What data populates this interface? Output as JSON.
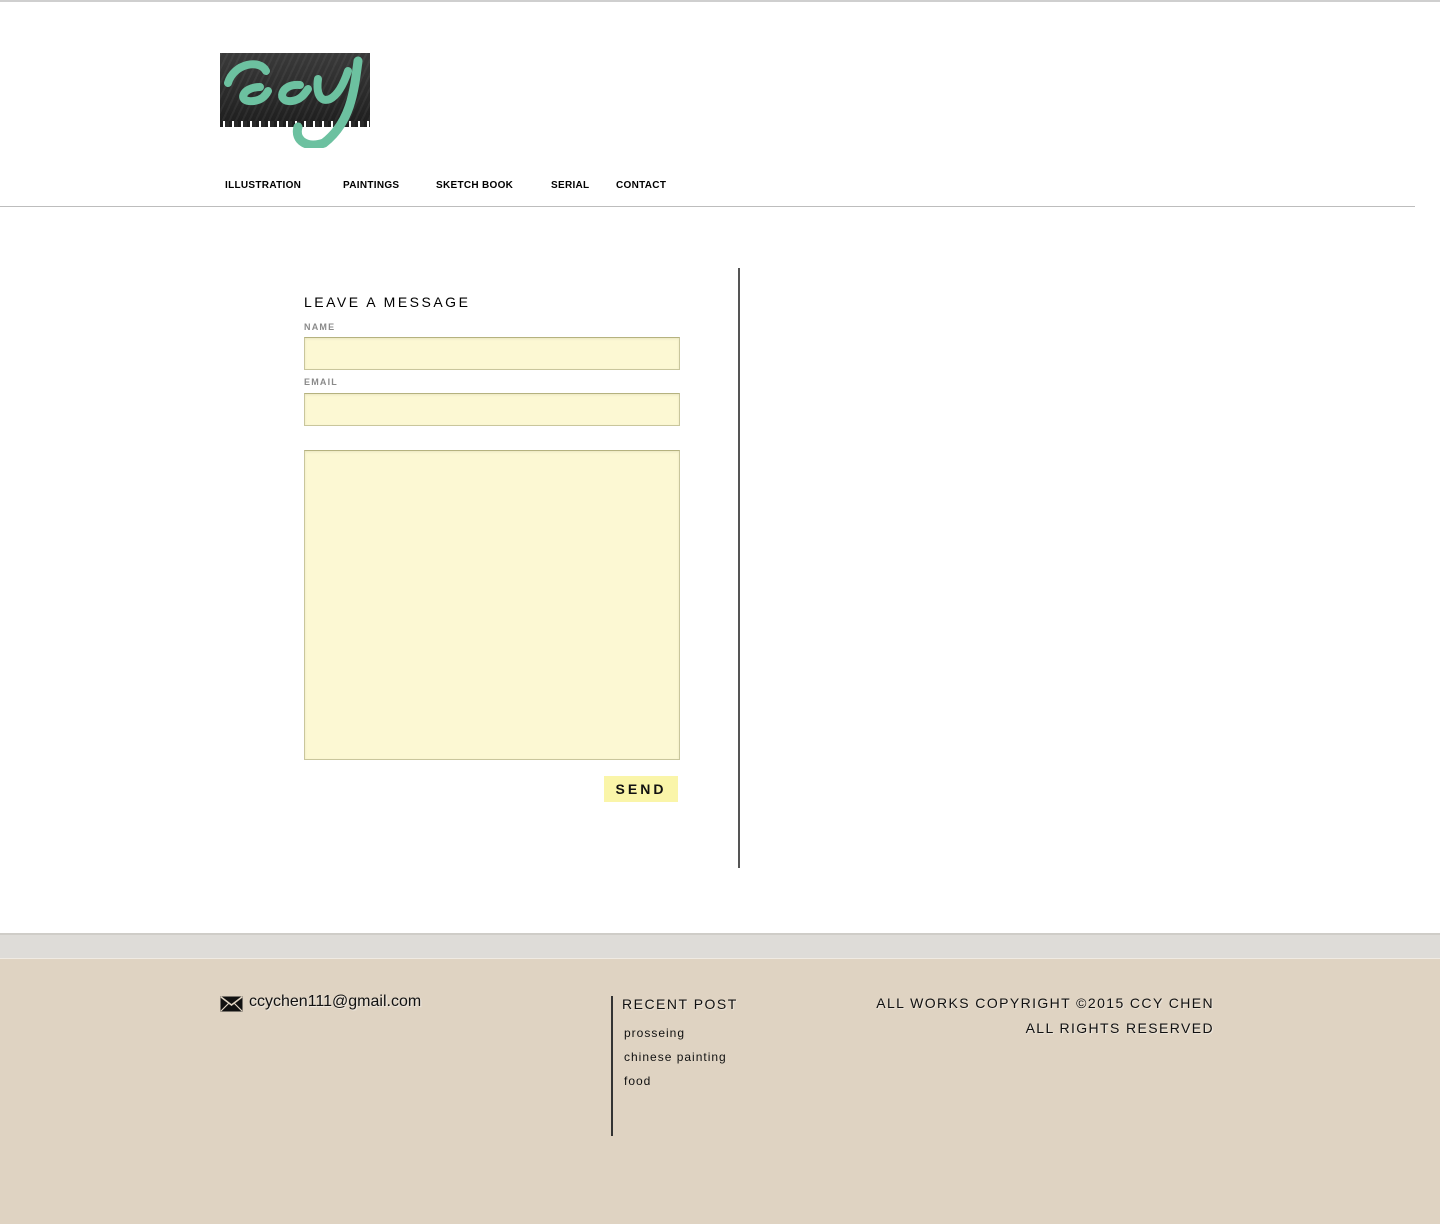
{
  "header": {
    "logo_text": "ccy"
  },
  "nav": {
    "items": [
      {
        "label": "ILLUSTRATION"
      },
      {
        "label": "PAINTINGS"
      },
      {
        "label": "SKETCH BOOK"
      },
      {
        "label": "SERIAL"
      },
      {
        "label": "CONTACT"
      }
    ]
  },
  "form": {
    "title": "LEAVE A MESSAGE",
    "name_label": "NAME",
    "name_value": "",
    "email_label": "EMAIL",
    "email_value": "",
    "message_value": "",
    "send_label": "SEND"
  },
  "footer": {
    "email": "ccychen111@gmail.com",
    "recent_title": "RECENT POST",
    "recent_posts": [
      {
        "label": "prosseing"
      },
      {
        "label": "chinese painting"
      },
      {
        "label": "food"
      }
    ],
    "copyright_line1": "ALL WORKS COPYRIGHT ©2015 CCY CHEN",
    "copyright_line2": "ALL RIGHTS RESERVED"
  },
  "colors": {
    "input_bg": "#fcf8d3",
    "button_bg": "#faf5a9",
    "footer_bg": "#dfd3c2",
    "logo_accent": "#6cc1a0"
  },
  "icons": {
    "mail": "envelope-icon"
  }
}
